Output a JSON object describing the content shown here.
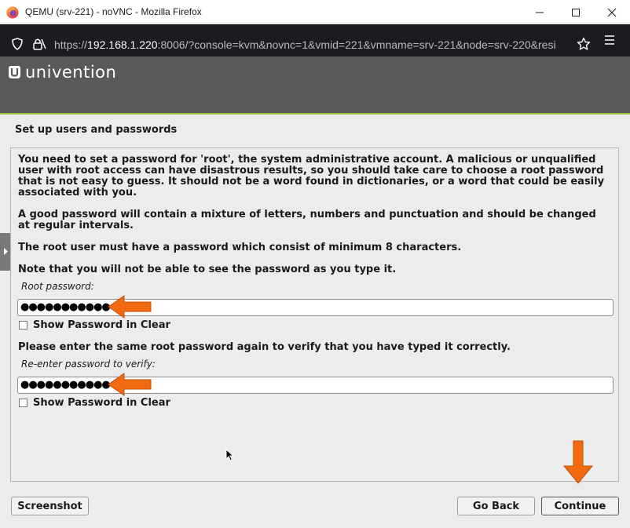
{
  "window": {
    "title": "QEMU (srv-221) - noVNC - Mozilla Firefox",
    "controls": {
      "minimize": "minimize-icon",
      "maximize": "maximize-icon",
      "close": "close-icon"
    }
  },
  "address_bar": {
    "url_prefix": "https://",
    "url_host": "192.168.1.220",
    "url_rest": ":8006/?console=kvm&novnc=1&vmid=221&vmname=srv-221&node=srv-220&resi",
    "icons": [
      "shield-icon",
      "lock-icon",
      "star-icon",
      "hamburger-menu-icon"
    ]
  },
  "header": {
    "logo_text": "univention"
  },
  "installer": {
    "section_title": "Set up users and passwords",
    "paragraphs": [
      "You need to set a password for 'root', the system administrative account. A malicious or unqualified user with root access can have disastrous results, so you should take care to choose a root password that is not easy to guess. It should not be a word found in dictionaries, or a word that could be easily associated with you.",
      "A good password will contain a mixture of letters, numbers and punctuation and should be changed at regular intervals.",
      "The root user must have a password which consist of minimum 8 characters.",
      "Note that you will not be able to see the password as you type it."
    ],
    "root_password": {
      "label": "Root password:",
      "value": "●●●●●●●●●●●",
      "show_clear_label": "Show Password in Clear",
      "show_clear_checked": false
    },
    "verify_prompt": "Please enter the same root password again to verify that you have typed it correctly.",
    "verify_password": {
      "label": "Re-enter password to verify:",
      "value": "●●●●●●●●●●●",
      "show_clear_label": "Show Password in Clear",
      "show_clear_checked": false
    },
    "buttons": {
      "screenshot": "Screenshot",
      "go_back": "Go Back",
      "continue": "Continue"
    }
  },
  "colors": {
    "header_bg": "#58595b",
    "header_accent": "#9ac43d",
    "installer_bg": "#ececec",
    "annotation_arrow": "#f26a10",
    "browser_chrome": "#1c1b22"
  }
}
